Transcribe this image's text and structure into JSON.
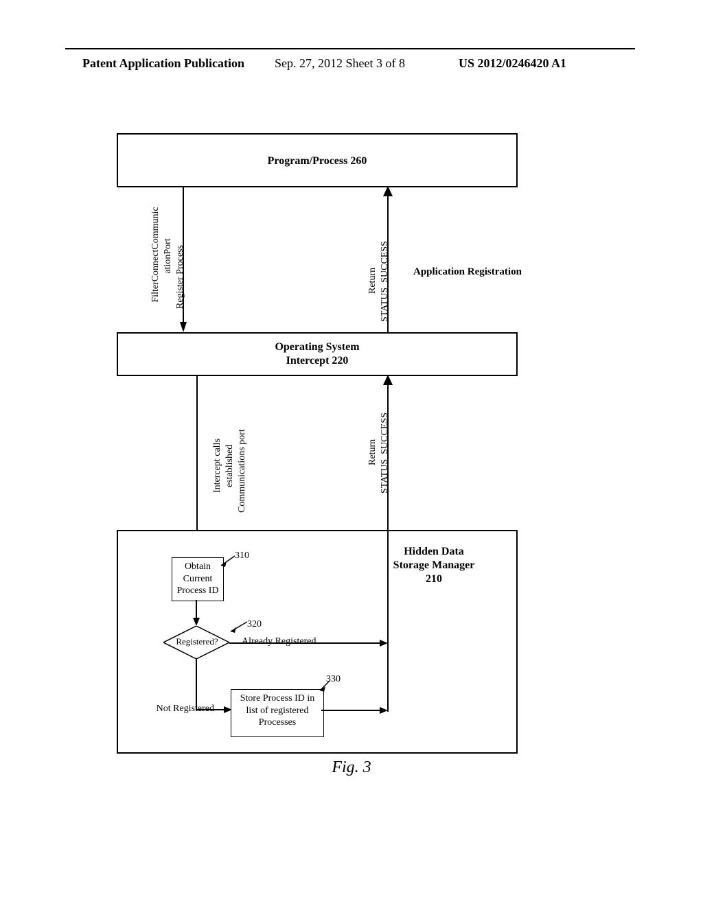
{
  "header": {
    "left": "Patent Application Publication",
    "mid": "Sep. 27, 2012  Sheet 3 of 8",
    "right": "US 2012/0246420 A1"
  },
  "boxes": {
    "b260": "Program/Process 260",
    "b220_l1": "Operating System",
    "b220_l2": "Intercept 220",
    "b210_l1": "Hidden Data",
    "b210_l2": "Storage Manager",
    "b210_l3": "210",
    "b310_l1": "Obtain",
    "b310_l2": "Current",
    "b310_l3": "Process ID",
    "b330_l1": "Store Process ID in",
    "b330_l2": "list of registered",
    "b330_l3": "Processes"
  },
  "decision": {
    "label": "Registered?",
    "already": "Already Registered",
    "notreg": "Not Registered"
  },
  "refs": {
    "r310": "310",
    "r320": "320",
    "r330": "330"
  },
  "sidelabel": "Application Registration",
  "vlabels": {
    "a1_l1": "FilterConnectCommunic",
    "a1_l2": "ationPort",
    "a1_l3": "Register Process",
    "a2_l1": "Return",
    "a2_l2": "STATUS_SUCCESS",
    "a3_l1": "Intercept calls",
    "a3_l2": "established",
    "a3_l3": "Communications port",
    "a4_l1": "Return",
    "a4_l2": "STATUS_SUCCESS"
  },
  "figcaption": "Fig. 3"
}
